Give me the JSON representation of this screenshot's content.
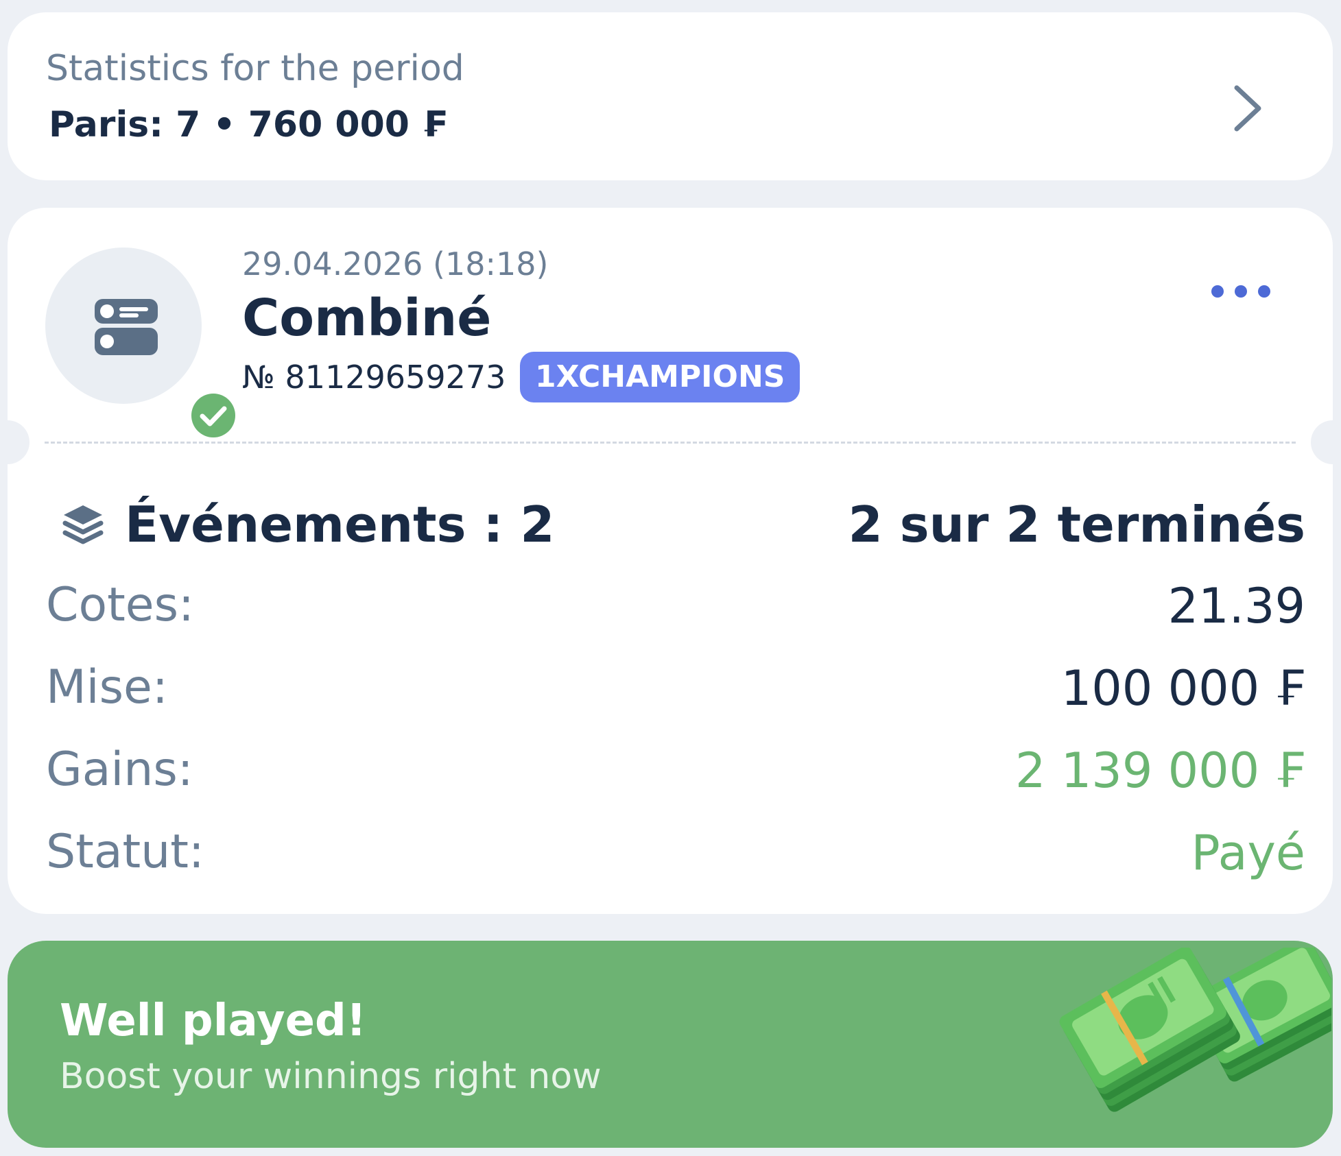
{
  "stats": {
    "title": "Statistics for the period",
    "value": "Paris: 7 • 760 000 ₣",
    "chevron_icon": "chevron-right-icon"
  },
  "bet": {
    "date": "29.04.2026 (18:18)",
    "type": "Combiné",
    "number": "№ 81129659273",
    "badge": "1XCHAMPIONS",
    "type_icon": "combo-bet-icon",
    "status_icon": "check-circle-icon",
    "more_icon": "more-horizontal-icon",
    "events": {
      "icon": "layers-icon",
      "label": "Événements : 2",
      "status": "2 sur 2 terminés"
    },
    "odds": {
      "label": "Cotes:",
      "value": "21.39"
    },
    "stake": {
      "label": "Mise:",
      "value": "100 000 ₣"
    },
    "winnings": {
      "label": "Gains:",
      "value": "2 139 000 ₣"
    },
    "status": {
      "label": "Statut:",
      "value": "Payé"
    }
  },
  "promo": {
    "title": "Well played!",
    "subtitle": "Boost your winnings right now",
    "illustration": "money-stack-icon"
  },
  "colors": {
    "background": "#edf0f5",
    "text_primary": "#1a2b45",
    "text_secondary": "#6c7f95",
    "accent_green": "#6bb572",
    "badge_blue": "#6b82f0",
    "promo_green": "#6db373"
  }
}
